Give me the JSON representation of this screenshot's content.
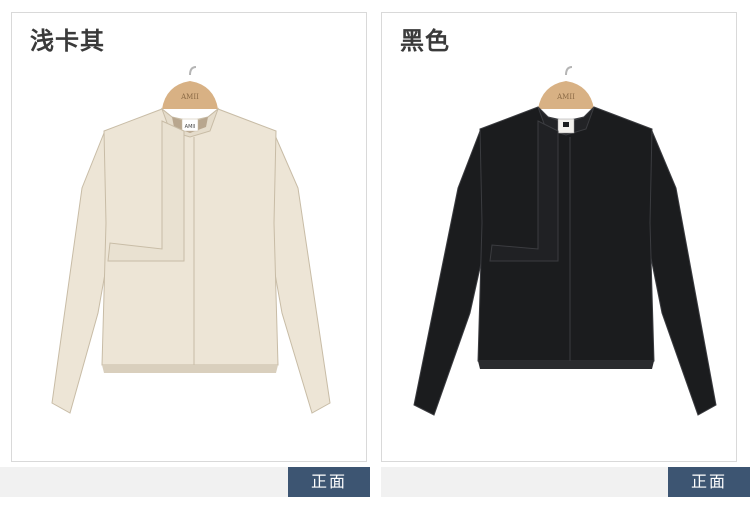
{
  "products": [
    {
      "color_name": "浅卡其",
      "view_label": "正面",
      "hanger_brand": "AMII",
      "tag_brand": "AMII",
      "colors": {
        "body": "#ede5d6",
        "shade": "#d9cfbd",
        "line": "#c8bca6",
        "collar_inner": "#b8a68e",
        "hanger": "#d8b184"
      }
    },
    {
      "color_name": "黑色",
      "view_label": "正面",
      "hanger_brand": "AMII",
      "tag_brand": "",
      "colors": {
        "body": "#1b1c1e",
        "shade": "#2a2b2e",
        "line": "#3b3c40",
        "collar_inner": "#101011",
        "hanger": "#d8b184"
      }
    }
  ]
}
